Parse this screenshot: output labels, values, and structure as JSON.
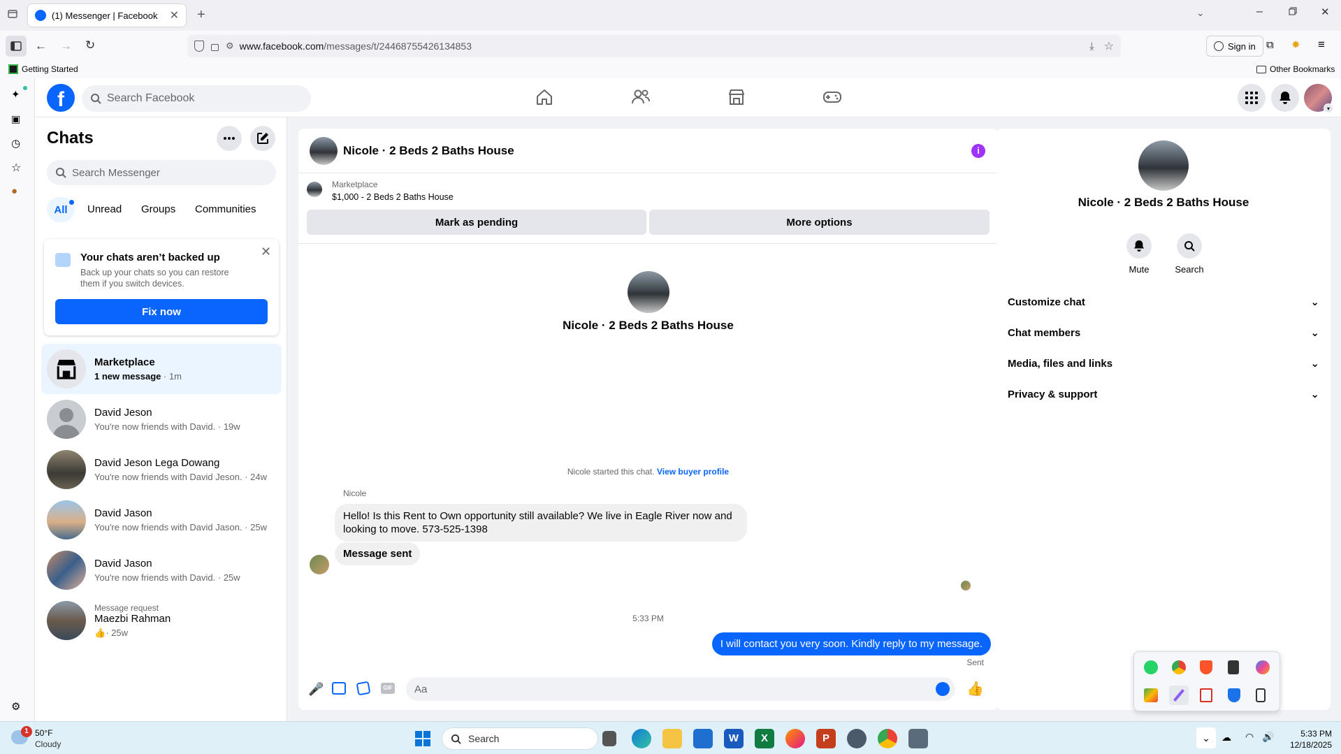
{
  "browser": {
    "tab_title": "(1) Messenger | Facebook",
    "url_host": "www.facebook.com",
    "url_path": "/messages/t/24468755426134853",
    "sign_in_label": "Sign in",
    "bookmark_getting_started": "Getting Started",
    "other_bookmarks": "Other Bookmarks"
  },
  "fb_header": {
    "search_placeholder": "Search Facebook"
  },
  "chats": {
    "title": "Chats",
    "search_placeholder": "Search Messenger",
    "filters": [
      "All",
      "Unread",
      "Groups",
      "Communities"
    ],
    "backup_title": "Your chats aren’t backed up",
    "backup_text": "Back up your chats so you can restore them if you switch devices.",
    "backup_button": "Fix now",
    "items": [
      {
        "name": "Marketplace",
        "sub": "1 new message",
        "time": "1m"
      },
      {
        "name": "David Jeson",
        "sub": "You're now friends with David.",
        "time": "19w"
      },
      {
        "name": "David Jeson Lega Dowang",
        "sub": "You're now friends with David Jeson.",
        "time": "24w"
      },
      {
        "name": "David Jason",
        "sub": "You're now friends with David Jason.",
        "time": "25w"
      },
      {
        "name": "David Jason",
        "sub": "You're now friends with David.",
        "time": "25w"
      },
      {
        "request_label": "Message request",
        "name": "Maezbi Rahman",
        "time": "25w"
      }
    ]
  },
  "conversation": {
    "title": "Nicole · 2 Beds 2 Baths House",
    "listing_label": "Marketplace",
    "listing_price": "$1,000 - 2 Beds 2 Baths House",
    "mark_pending": "Mark as pending",
    "more_options": "More options",
    "intro_name": "Nicole · 2 Beds 2 Baths House",
    "started_text": "Nicole started this chat.",
    "view_buyer_profile": "View buyer profile",
    "sender_name": "Nicole",
    "msg1": "Hello! Is this Rent to Own opportunity still available? We live in Eagle River now and looking to move. 573-525-1398",
    "msg2": "Message sent",
    "timestamp": "5:33 PM",
    "my_msg": "I will contact you very soon. Kindly reply to my message.",
    "sent_status": "Sent",
    "composer_placeholder": "Aa"
  },
  "info_panel": {
    "name": "Nicole · 2 Beds 2 Baths House",
    "mute_label": "Mute",
    "search_label": "Search",
    "sections": [
      "Customize chat",
      "Chat members",
      "Media, files and links",
      "Privacy & support"
    ]
  },
  "taskbar": {
    "weather_temp": "50°F",
    "weather_desc": "Cloudy",
    "weather_badge": "1",
    "search_label": "Search",
    "time": "5:33 PM",
    "date": "12/18/2025"
  },
  "colors": {
    "fb_blue": "#0866ff",
    "messenger_purple": "#a033ff",
    "bubble_grey": "#f0f0f0"
  }
}
